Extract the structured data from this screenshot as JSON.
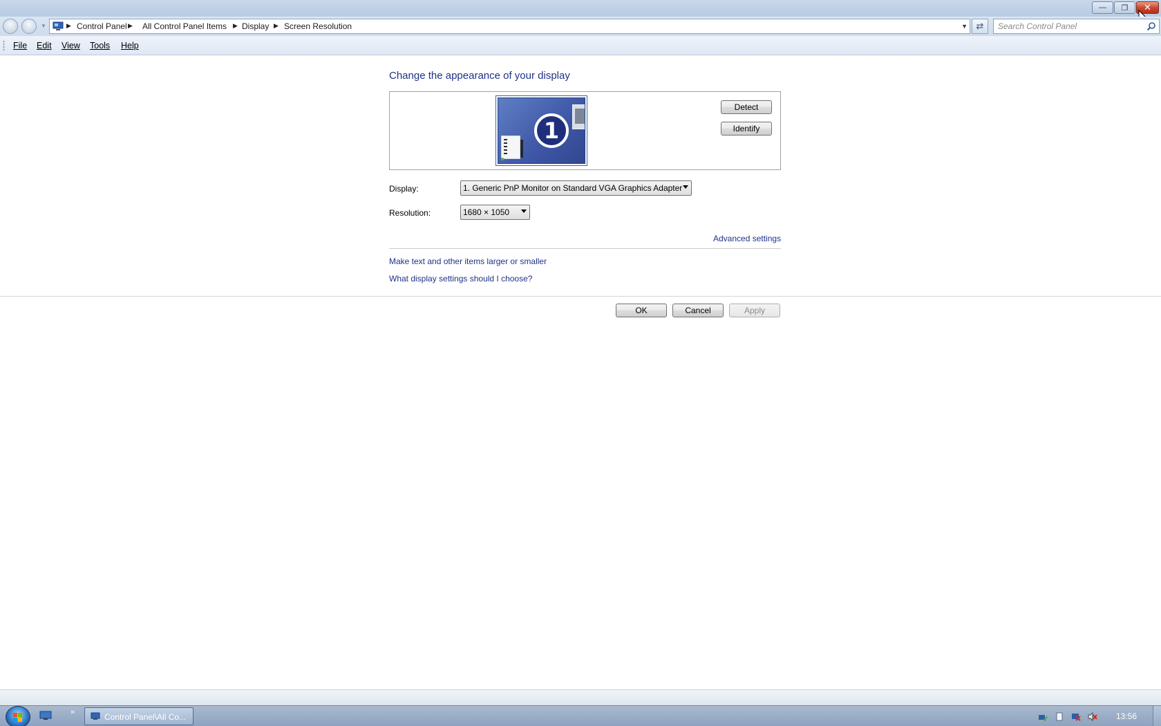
{
  "window": {
    "minimize_icon": "minimize-icon",
    "restore_icon": "restore-icon",
    "close_icon": "close-icon"
  },
  "address_bar": {
    "breadcrumbs": [
      "Control Panel",
      "All Control Panel Items",
      "Display",
      "Screen Resolution"
    ],
    "search_placeholder": "Search Control Panel"
  },
  "menu": {
    "items": [
      "File",
      "Edit",
      "View",
      "Tools",
      "Help"
    ]
  },
  "content": {
    "title": "Change the appearance of your display",
    "monitor_number": "1",
    "detect_label": "Detect",
    "identify_label": "Identify",
    "display_label": "Display:",
    "display_value": "1. Generic PnP Monitor on Standard VGA Graphics Adapter",
    "resolution_label": "Resolution:",
    "resolution_value": "1680 × 1050",
    "advanced_settings": "Advanced settings",
    "link_text_size": "Make text and other items larger or smaller",
    "link_help": "What display settings should I choose?"
  },
  "buttons": {
    "ok": "OK",
    "cancel": "Cancel",
    "apply": "Apply"
  },
  "taskbar": {
    "task_label": "Control Panel\\All Co...",
    "clock": "13:56",
    "chevron": "»"
  },
  "colors": {
    "link": "#1e3287",
    "title_bar": "#c9d8ea",
    "close_button": "#c8442a",
    "taskbar": "#8ea3bf"
  }
}
